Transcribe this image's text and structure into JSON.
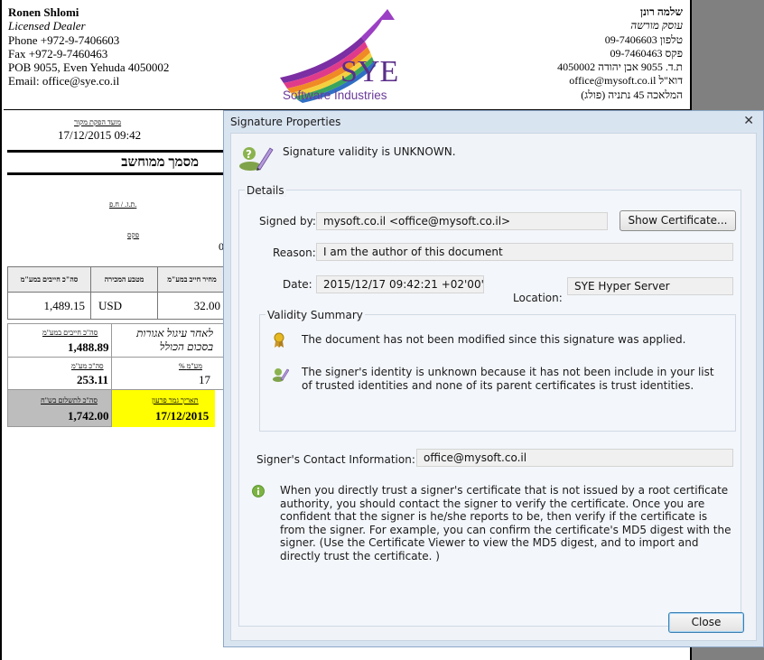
{
  "sender": {
    "name": "Ronen Shlomi",
    "license": "Licensed Dealer",
    "phone": "Phone +972-9-7406603",
    "fax": "Fax +972-9-7460463",
    "pob": "POB 9055, Even Yehuda 4050002",
    "email": "Email: office@sye.co.il"
  },
  "sender_hebrew": {
    "name": "שלמה רונן",
    "license": "עוסק מורשה",
    "phone": "טלפון 09-7406603",
    "fax": "פקס 09-7460463",
    "pob": "ת.ד. 9055 אבן יהודה 4050002",
    "email": "דוא\"ל office@mysoft.co.il",
    "address": "המלאכה 45 נתניה (פולג)"
  },
  "logo": {
    "letters": "SYE",
    "tagline": "Software Industries",
    "colors": [
      "#7b2fa3",
      "#e03b8b",
      "#f08a24",
      "#f4d03f",
      "#3aa55b",
      "#2f6fc4"
    ]
  },
  "document": {
    "issue_label": "מועד הפקת מקור",
    "issue_value": "17/12/2015 09:42",
    "title": "מסמך ממוחשב",
    "tz_label": "ת.ז. / ח.פ.",
    "fax_label": "פקס",
    "zero": "0",
    "items_headers": [
      "סה\"כ חייבים במע\"מ",
      "מטבע המכירה",
      "מחיר חייב במע\"מ"
    ],
    "items_row": [
      "1,489.15",
      "USD",
      "32.00"
    ],
    "summary": {
      "taxable_label": "סה\"כ חייבים במע\"מ",
      "taxable_value": "1,488.89",
      "note": "לאחר עיגול אגורות בסכום הכולל",
      "vat_label": "סה\"כ מע\"מ",
      "vat_value": "253.11",
      "vat_pct_label": "% מע\"מ",
      "vat_pct_value": "17",
      "total_label": "סה\"כ לתשלום בש\"ח",
      "total_value": "1,742.00",
      "due_label": "תאריך גמר פרעון",
      "due_value": "17/12/2015",
      "total_bg": "#bdbdbd",
      "due_bg": "#ffff00"
    }
  },
  "dialog": {
    "title": "Signature Properties",
    "validity": "Signature validity is UNKNOWN.",
    "details_label": "Details",
    "signed_by_label": "Signed by:",
    "signed_by_value": "mysoft.co.il <office@mysoft.co.il>",
    "show_certificate": "Show Certificate...",
    "reason_label": "Reason:",
    "reason_value": "I am the author of this document",
    "date_label": "Date:",
    "date_value": "2015/12/17 09:42:21 +02'00'",
    "location_label": "Location:",
    "location_value": "SYE Hyper Server",
    "validity_summary_label": "Validity Summary",
    "summary_item_1": "The document has not been modified since this signature was applied.",
    "summary_item_2": "The signer's identity is unknown because it has not been include in your list of trusted identities and none of its parent certificates is trust identities.",
    "contact_label": "Signer's Contact Information:",
    "contact_value": "office@mysoft.co.il",
    "info_text": "When you directly trust a signer's certificate that is not issued by a root certificate authority, you should contact the signer to verify the certificate. Once you are confident that the signer is he/she reports to be, then verify if the certificate is from the signer. For example, you can confirm the certificate's MD5 digest with the signer. (Use the Certificate Viewer to view the MD5 digest, and to import and directly trust the certificate. )",
    "close_button": "Close",
    "icons": [
      "certificate-signature-icon",
      "close-icon",
      "ribbon-icon",
      "signer-icon",
      "info-icon"
    ]
  }
}
